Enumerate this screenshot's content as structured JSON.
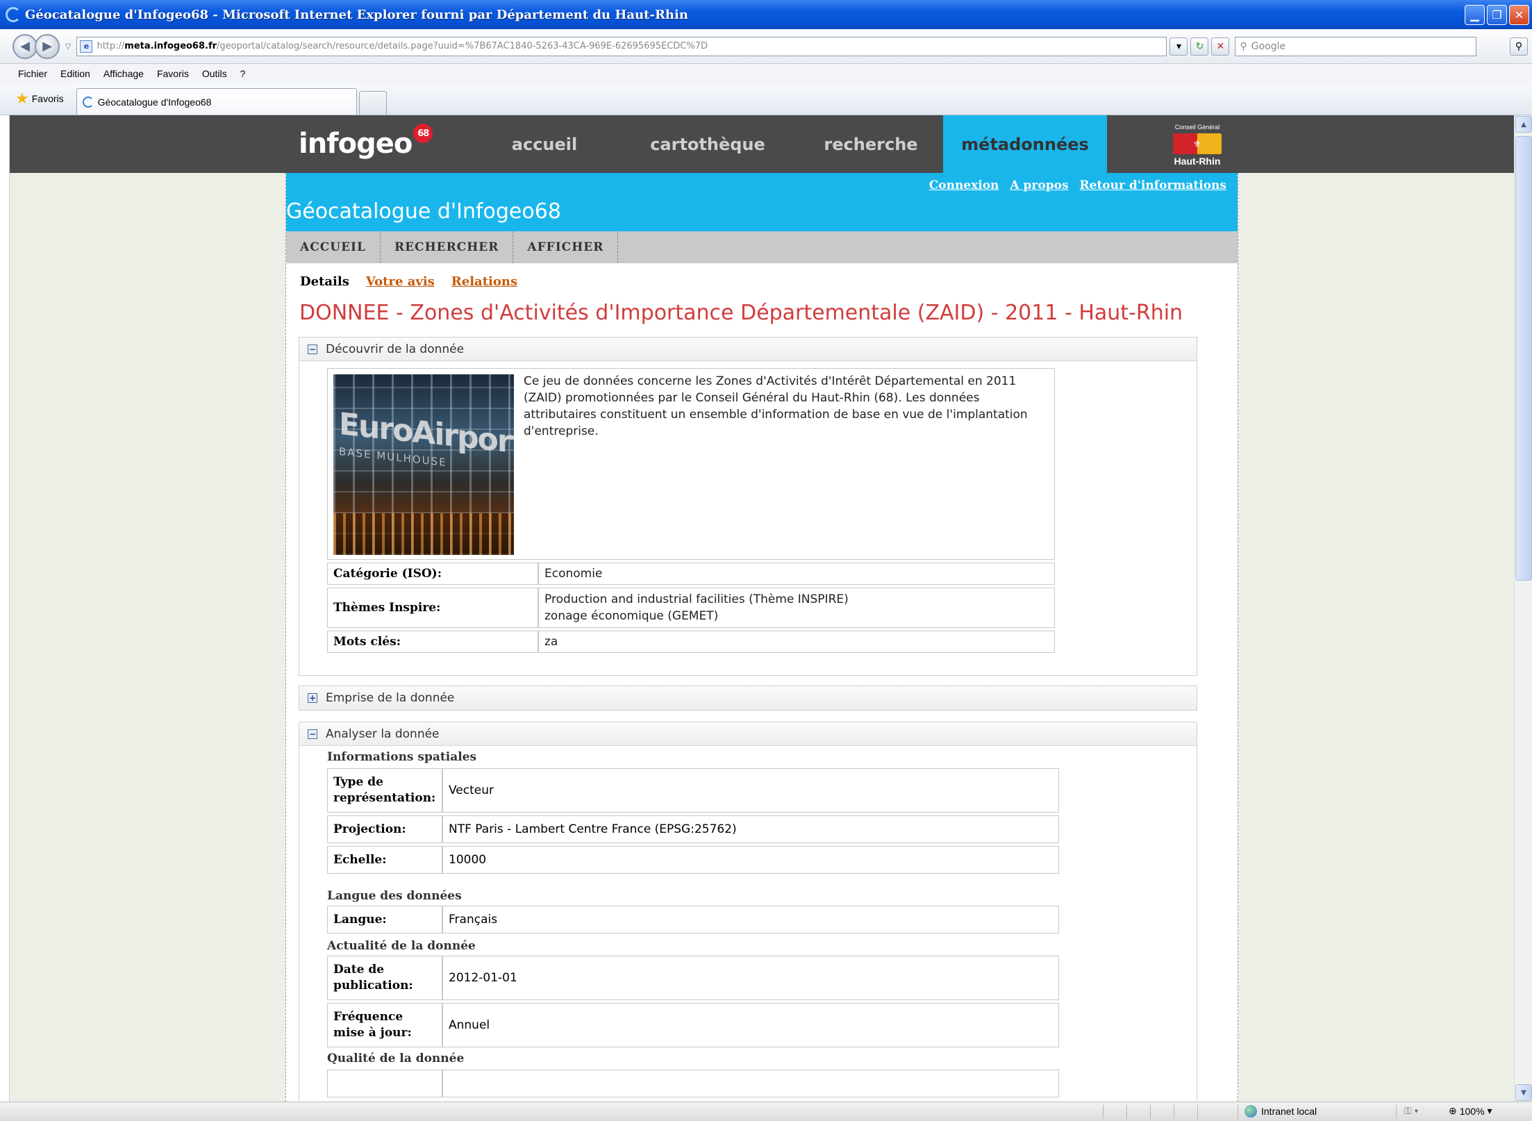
{
  "window": {
    "title": "Géocatalogue d'Infogeo68 - Microsoft Internet Explorer fourni par Département du Haut-Rhin"
  },
  "address": {
    "url_prefix": "http://",
    "url_host": "meta.infogeo68.fr",
    "url_path": "/geoportal/catalog/search/resource/details.page?uuid=%7B67AC1840-5263-43CA-969E-62695695ECDC%7D",
    "search_placeholder": "Google"
  },
  "menu": [
    "Fichier",
    "Edition",
    "Affichage",
    "Favoris",
    "Outils",
    "?"
  ],
  "favorites": {
    "label": "Favoris",
    "tab_title": "Géocatalogue d'Infogeo68"
  },
  "site": {
    "logo": "infogeo",
    "logo_badge": "68",
    "nav": {
      "accueil": "accueil",
      "cartotheque": "cartothèque",
      "recherche": "recherche",
      "metadonnees": "métadonnées"
    },
    "cg_small": "Conseil Général",
    "cg_name": "Haut-Rhin"
  },
  "page": {
    "links": {
      "connexion": "Connexion",
      "apropos": "A propos",
      "retour": "Retour d'informations"
    },
    "title": "Géocatalogue d'Infogeo68",
    "subnav": [
      "ACCUEIL",
      "RECHERCHER",
      "AFFICHER"
    ],
    "tabs": {
      "details": "Details",
      "avis": "Votre avis",
      "relations": "Relations"
    },
    "doc_title": "DONNEE - Zones d'Activités d'Importance Départementale (ZAID) - 2011 - Haut-Rhin"
  },
  "panel1": {
    "header": "Découvrir de la donnée",
    "image_text": "EuroAirport",
    "image_subtext": "BASE MULHOUSE",
    "description": "Ce jeu de données concerne les Zones d'Activités d'Intérêt Départemental en 2011 (ZAID) promotionnées par le Conseil Général du Haut-Rhin (68). Les données attributaires constituent un ensemble d'information de base en vue de l'implantation d'entreprise.",
    "rows": [
      {
        "key": "Catégorie (ISO):",
        "value": "Economie"
      },
      {
        "key": "Thèmes Inspire:",
        "value": "Production and industrial facilities (Thème INSPIRE)",
        "value2": "zonage économique (GEMET)"
      },
      {
        "key": "Mots clés:",
        "value": "za"
      }
    ]
  },
  "panel2": {
    "header": "Emprise de la donnée"
  },
  "panel3": {
    "header": "Analyser la donnée",
    "sections": {
      "spatial": "Informations spatiales",
      "langue": "Langue des données",
      "actualite": "Actualité de la donnée",
      "qualite": "Qualité de la donnée"
    },
    "spatial_rows": [
      {
        "key": "Type de représentation:",
        "value": "Vecteur"
      },
      {
        "key": "Projection:",
        "value": "NTF Paris - Lambert Centre France (EPSG:25762)"
      },
      {
        "key": "Echelle:",
        "value": "10000"
      }
    ],
    "langue_rows": [
      {
        "key": "Langue:",
        "value": "Français"
      }
    ],
    "actualite_rows": [
      {
        "key": "Date de publication:",
        "value": "2012-01-01"
      },
      {
        "key": "Fréquence mise à jour:",
        "value": "Annuel"
      }
    ]
  },
  "status": {
    "zone": "Intranet local",
    "zoom": "100%"
  }
}
